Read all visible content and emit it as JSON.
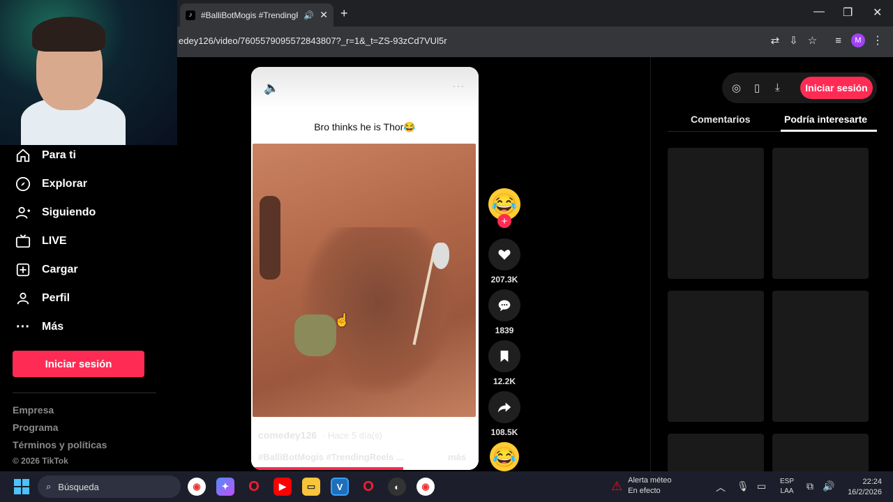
{
  "browser": {
    "tab_title": "#BalliBotMogis #TrendingRe",
    "url": "edey126/video/7605579095572843807?_r=1&_t=ZS-93zCd7VUl5r",
    "profile_initial": "M"
  },
  "sidebar": {
    "items": [
      {
        "label": "Para ti",
        "icon": "home-icon"
      },
      {
        "label": "Explorar",
        "icon": "compass-icon"
      },
      {
        "label": "Siguiendo",
        "icon": "following-icon"
      },
      {
        "label": "LIVE",
        "icon": "live-tv-icon"
      },
      {
        "label": "Cargar",
        "icon": "upload-icon"
      },
      {
        "label": "Perfil",
        "icon": "profile-icon"
      },
      {
        "label": "Más",
        "icon": "more-icon"
      }
    ],
    "login_label": "Iniciar sesión",
    "footer": [
      "Empresa",
      "Programa",
      "Términos y políticas",
      "© 2026 TikTok"
    ]
  },
  "video": {
    "caption": "Bro thinks he is Thor😂",
    "author": "comedey126",
    "posted": "· Hace 5 día(s)",
    "hashtags": "#BalliBotMogis #TrendingReels ...",
    "more_label": "más",
    "progress": 0.67
  },
  "actions": {
    "likes": "207.3K",
    "comments": "1839",
    "saves": "12.2K",
    "shares": "108.5K"
  },
  "right_panel": {
    "login_label": "Iniciar sesión",
    "tabs": [
      "Comentarios",
      "Podría interesarte"
    ],
    "active_tab": 1
  },
  "taskbar": {
    "search_placeholder": "Búsqueda",
    "weather_title": "Alerta méteo",
    "weather_sub": "En efecto",
    "lang_line1": "ESP",
    "lang_line2": "LAA",
    "time": "22:24",
    "date": "16/2/2026"
  },
  "colors": {
    "accent": "#fe2c55",
    "background": "#000000",
    "panel": "#1a1a1a"
  }
}
